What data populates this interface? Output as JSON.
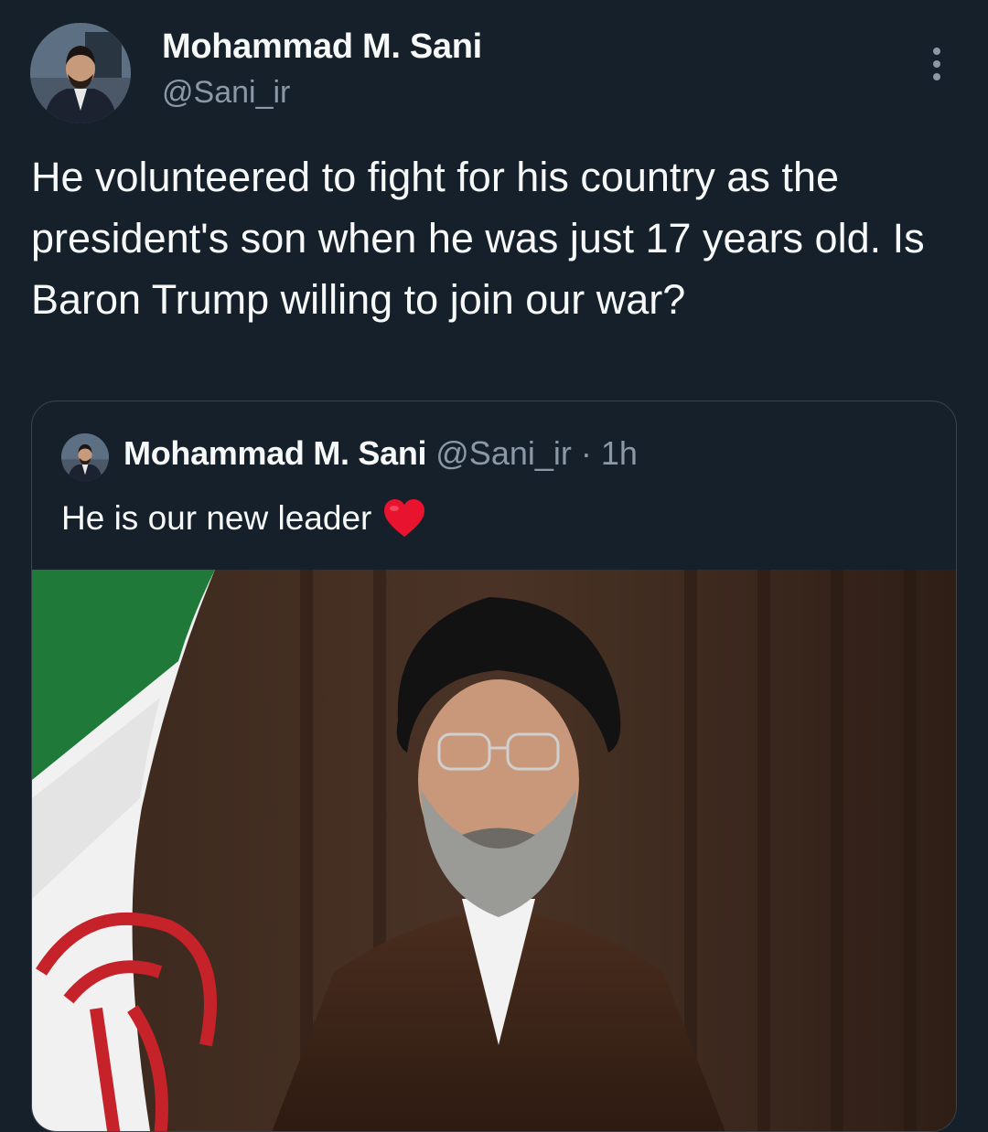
{
  "author": {
    "display_name": "Mohammad M. Sani",
    "handle": "@Sani_ir"
  },
  "tweet": {
    "text": "He volunteered to fight for his country as the president's son when he was just 17 years old. Is Baron Trump willing to join our war?"
  },
  "quoted_tweet": {
    "display_name": "Mohammad M. Sani",
    "handle": "@Sani_ir",
    "separator": "·",
    "time": "1h",
    "text": "He is our new leader",
    "emoji_icon": "red-heart-icon"
  },
  "icons": {
    "more": "more-options-icon"
  },
  "colors": {
    "background": "#15202b",
    "primary_text": "#f7f9f9",
    "secondary_text": "#8b98a5",
    "border": "#38444d",
    "heart": "#f91880"
  }
}
